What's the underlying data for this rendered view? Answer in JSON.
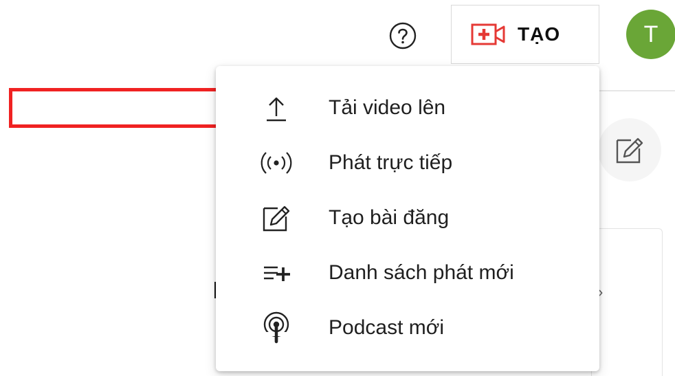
{
  "header": {
    "help_icon": "help-circle-icon",
    "create_button": {
      "label": "TẠO",
      "icon": "video-camera-plus-icon",
      "icon_color": "#e53935"
    },
    "avatar": {
      "initial": "T",
      "color": "#6aa637"
    }
  },
  "create_menu": {
    "items": [
      {
        "label": "Tải video lên",
        "icon": "upload-icon"
      },
      {
        "label": "Phát trực tiếp",
        "icon": "live-broadcast-icon"
      },
      {
        "label": "Tạo bài đăng",
        "icon": "edit-post-icon"
      },
      {
        "label": "Danh sách phát mới",
        "icon": "playlist-add-icon"
      },
      {
        "label": "Podcast mới",
        "icon": "podcast-icon"
      }
    ]
  },
  "annotation": {
    "color": "#f02222"
  }
}
